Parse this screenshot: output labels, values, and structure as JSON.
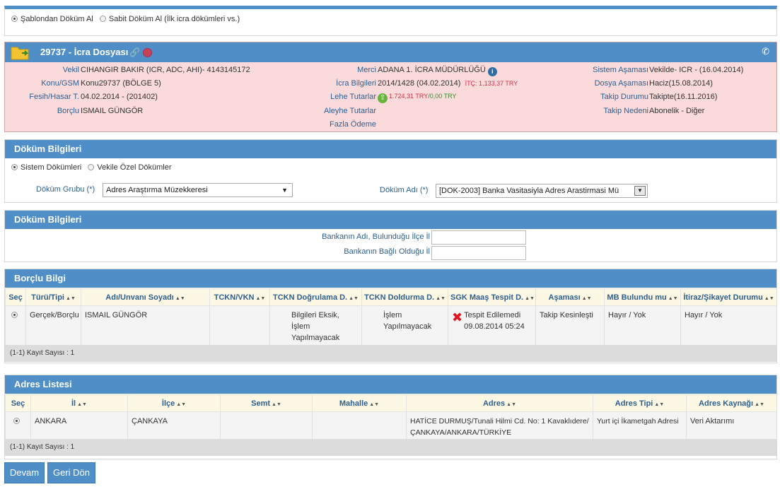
{
  "top": {
    "option1": "Şablondan Döküm Al",
    "option2": "Sabit Döküm Al (İlk icra dökümleri vs.)"
  },
  "icra": {
    "title": "29737 - İcra Dosyası",
    "fields": {
      "vekil_label": "Vekil",
      "vekil": "CIHANGIR BAKIR (ICR, ADC, AHI)- 4143145172",
      "konu_label": "Konu/GSM",
      "konu": "Konu29737 (BÖLGE 5)",
      "fesih_label": "Fesih/Hasar T.",
      "fesih": "04.02.2014 - (201402)",
      "borclu_label": "Borçlu",
      "borclu": "ISMAIL GÜNGÖR",
      "merci_label": "Merci",
      "merci": "ADANA 1. İCRA MÜDÜRLÜĞÜ",
      "icra_bilgileri_label": "İcra Bilgileri",
      "icra_bilgileri": "2014/1428 (04.02.2014)",
      "itc": "İTÇ: 1.133,37 TRY",
      "lehe_label": "Lehe Tutarlar",
      "lehe_red": "1.724,31 TRY",
      "lehe_sep": "/",
      "lehe_green": "0,00 TRY",
      "aleyhe_label": "Aleyhe Tutarlar",
      "fazla_label": "Fazla Ödeme",
      "sistem_asamasi_label": "Sistem Aşaması",
      "sistem_asamasi": "Vekilde- ICR - (16.04.2014)",
      "dosya_asamasi_label": "Dosya Aşaması",
      "dosya_asamasi": "Haciz(15.08.2014)",
      "takip_durumu_label": "Takip Durumu",
      "takip_durumu": "Takipte(16.11.2016)",
      "takip_nedeni_label": "Takip Nedeni",
      "takip_nedeni": "Abonelik - Diğer"
    }
  },
  "dok1": {
    "title": "Döküm Bilgileri",
    "radio1": "Sistem Dökümleri",
    "radio2": "Vekile Özel Dökümler",
    "grup_label": "Döküm Grubu (*)",
    "grup_value": "Adres Araştırma Müzekkeresi",
    "adi_label": "Döküm Adı (*)",
    "adi_value": "[DOK-2003] Banka Vasitasiyla Adres Arastirmasi Mü"
  },
  "dok2": {
    "title": "Döküm Bilgileri",
    "field1": "Bankanın Adı, Bulunduğu İlçe İl",
    "field2": "Bankanın Bağlı Olduğu İl"
  },
  "borclu": {
    "title": "Borçlu Bilgi",
    "columns": [
      "Seç",
      "Türü/Tipi",
      "Adı/Unvanı Soyadı",
      "TCKN/VKN",
      "TCKN Doğrulama D.",
      "TCKN Doldurma D.",
      "SGK Maaş Tespit D.",
      "Aşaması",
      "MB Bulundu mu",
      "İtiraz/Şikayet Durumu"
    ],
    "row": {
      "turu": "Gerçek/Borçlu",
      "adi": "ISMAIL GÜNGÖR",
      "tckn": "",
      "dogrulama": "Bilgileri Eksik, İşlem Yapılmayacak",
      "doldurma": "İşlem Yapılmayacak",
      "sgk": "Tespit Edilemedi 09.08.2014 05:24",
      "asamasi": "Takip Kesinleşti",
      "mb": "Hayır / Yok",
      "itiraz": "Hayır / Yok"
    },
    "footer": "(1-1) Kayıt Sayısı : 1"
  },
  "adres": {
    "title": "Adres Listesi",
    "columns": [
      "Seç",
      "İl",
      "İlçe",
      "Semt",
      "Mahalle",
      "Adres",
      "Adres Tipi",
      "Adres Kaynağı"
    ],
    "row": {
      "il": "ANKARA",
      "ilce": "ÇANKAYA",
      "semt": "",
      "mahalle": "",
      "adres": "HATİCE DURMUŞ/Tunali Hilmi Cd. No: 1 Kavaklıdere/ ÇANKAYA/ANKARA/TÜRKİYE",
      "tipi": "Yurt içi İkametgah Adresi",
      "kaynagi": "Veri Aktarımı"
    },
    "footer": "(1-1) Kayıt Sayısı : 1"
  },
  "buttons": {
    "devam": "Devam",
    "geri": "Geri Dön"
  }
}
